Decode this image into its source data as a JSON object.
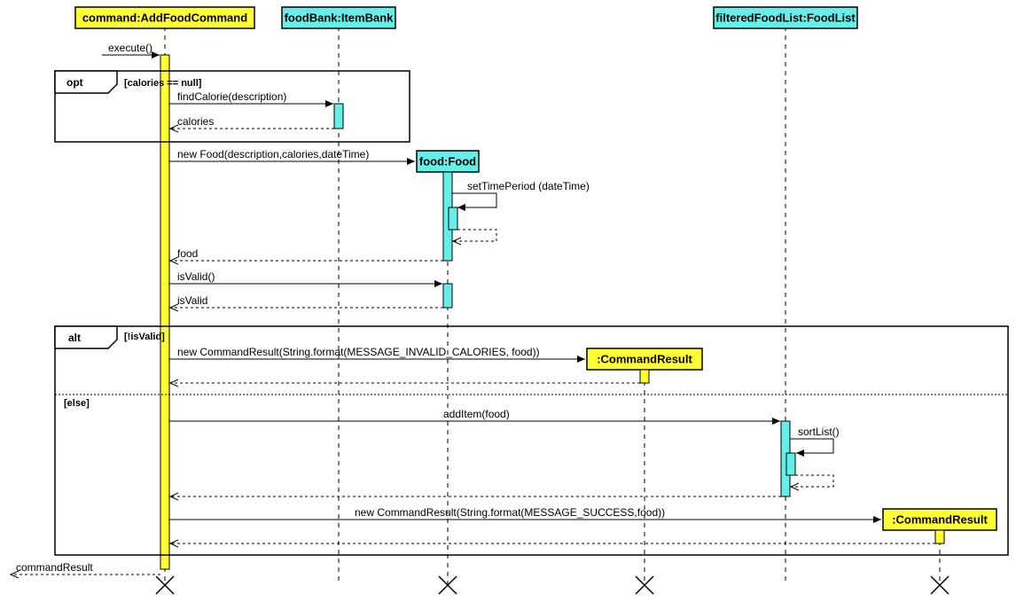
{
  "participants": {
    "command": "command:AddFoodCommand",
    "foodBank": "foodBank:ItemBank",
    "filteredFoodList": "filteredFoodList:FoodList",
    "food": "food:Food",
    "commandResult1": ":CommandResult",
    "commandResult2": ":CommandResult"
  },
  "messages": {
    "execute": "execute()",
    "findCalorie": "findCalorie(description)",
    "caloriesReturn": "calories",
    "newFood": "new Food(description,calories,dateTime)",
    "setTimePeriod": "setTimePeriod (dateTime)",
    "foodReturn": "food",
    "isValidCall": "isValid()",
    "isValidReturn": "isValid",
    "newCommandResultInvalid": "new CommandResult(String.format(MESSAGE_INVALID_CALORIES, food))",
    "addItem": "addItem(food)",
    "sortList": "sortList()",
    "newCommandResultSuccess": "new CommandResult(String.format(MESSAGE_SUCCESS,food))",
    "commandResultReturn": "commandResult"
  },
  "frames": {
    "opt": "opt",
    "optGuard": "[calories == null]",
    "alt": "alt",
    "altGuard1": "[!isValid]",
    "altGuard2": "[else]"
  }
}
